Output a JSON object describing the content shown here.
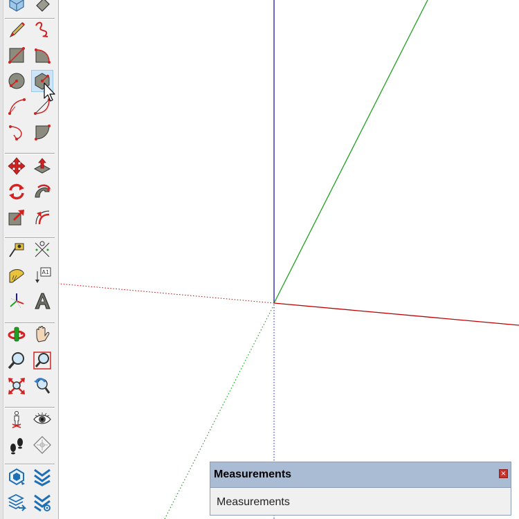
{
  "app": {
    "accent": "#a9bcd4"
  },
  "axes": {
    "red_color": "#c00000",
    "green_color": "#20a020",
    "blue_color": "#1a1aa8"
  },
  "toolbar": {
    "groups": [
      {
        "tools": [
          "select-icon",
          "paint-bucket-icon"
        ]
      },
      {
        "tools": [
          "pencil-line-icon",
          "freehand-icon",
          "rectangle-icon",
          "rotated-rectangle-icon",
          "circle-icon",
          "polygon-icon",
          "arc-icon",
          "two-point-arc-icon",
          "three-point-arc-icon",
          "pie-icon"
        ]
      },
      {
        "tools": [
          "move-icon",
          "push-pull-icon",
          "rotate-icon",
          "follow-me-icon",
          "scale-icon",
          "offset-icon"
        ]
      },
      {
        "tools": [
          "tape-measure-icon",
          "dimension-icon",
          "protractor-icon",
          "text-label-icon",
          "axes-icon",
          "3d-text-icon"
        ]
      },
      {
        "tools": [
          "orbit-icon",
          "pan-icon",
          "zoom-icon",
          "zoom-window-icon",
          "zoom-extents-icon",
          "previous-view-icon"
        ]
      },
      {
        "tools": [
          "position-camera-icon",
          "look-around-icon",
          "walk-icon",
          "section-plane-icon"
        ]
      },
      {
        "tools": [
          "extension-warehouse-icon",
          "sandbox-icon",
          "layers-icon",
          "sandbox-settings-icon"
        ]
      }
    ],
    "active_tool": "polygon-icon",
    "dimension_badge": "A1"
  },
  "measurements": {
    "title": "Measurements",
    "label": "Measurements",
    "close_symbol": "×"
  }
}
